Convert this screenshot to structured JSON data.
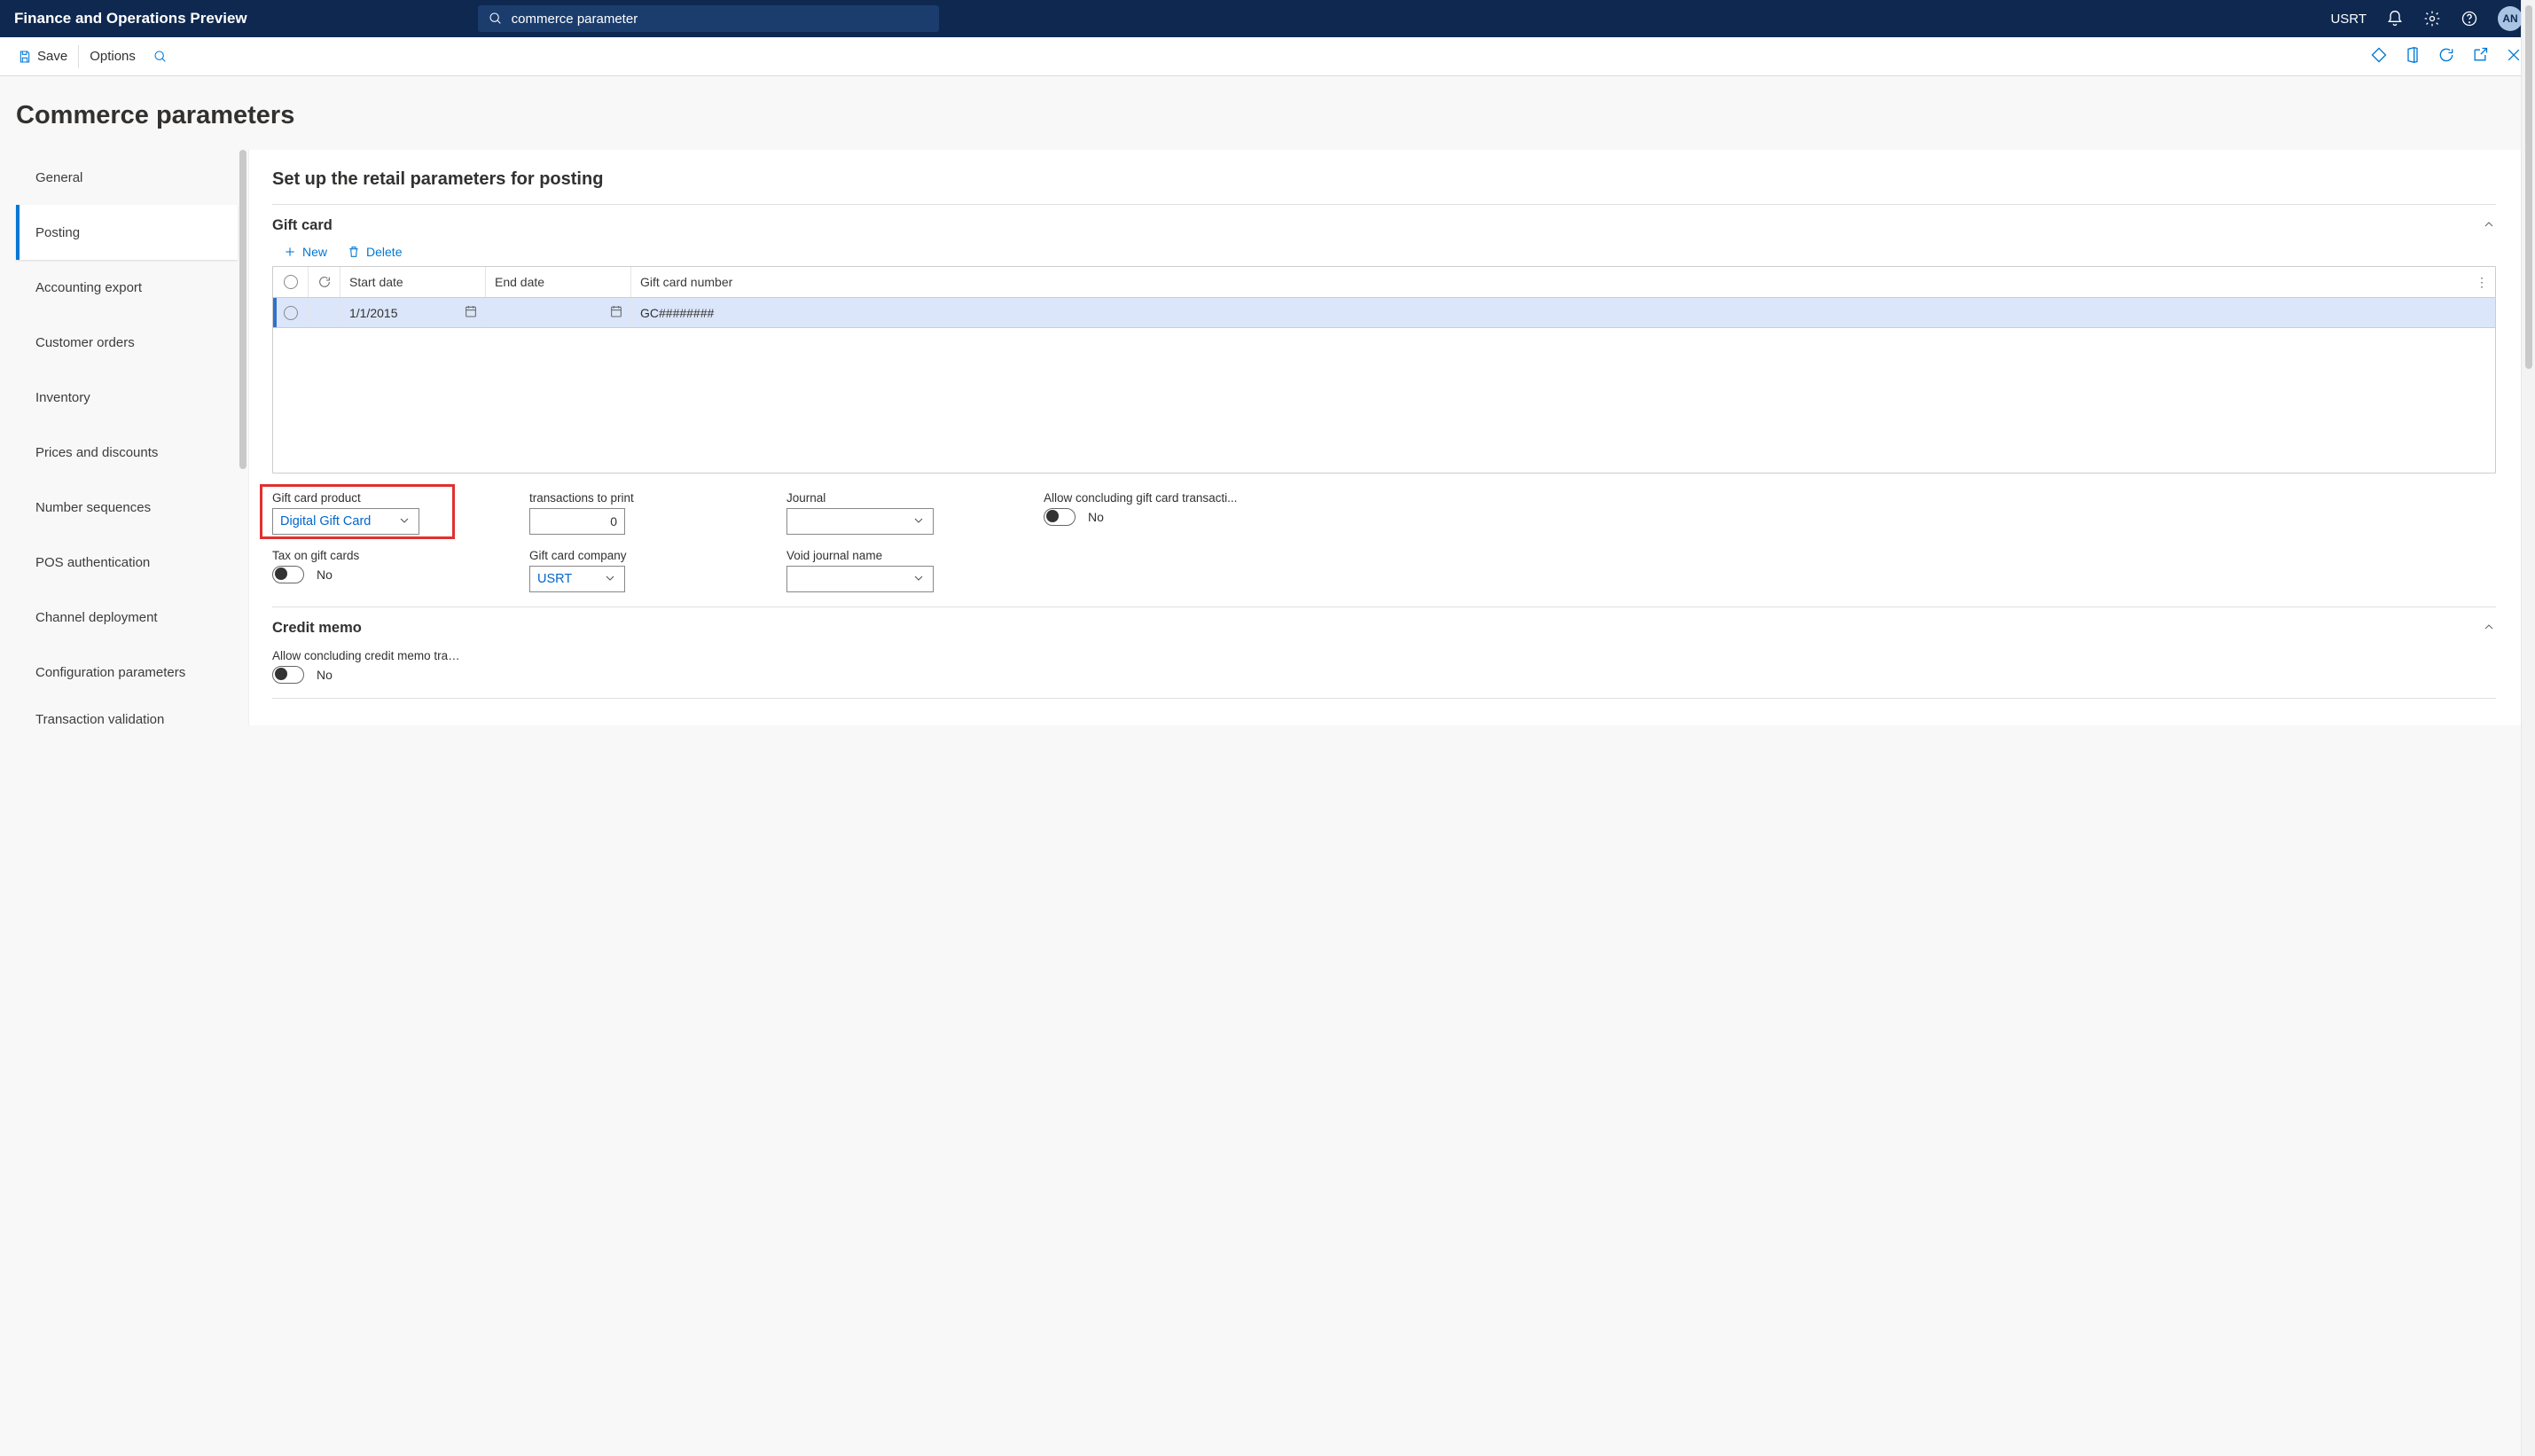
{
  "topbar": {
    "title": "Finance and Operations Preview",
    "search_value": "commerce parameter",
    "company": "USRT",
    "avatar": "AN"
  },
  "actionbar": {
    "save": "Save",
    "options": "Options"
  },
  "page": {
    "title": "Commerce parameters",
    "pane_title": "Set up the retail parameters for posting"
  },
  "sidebar": {
    "items": [
      {
        "label": "General"
      },
      {
        "label": "Posting"
      },
      {
        "label": "Accounting export"
      },
      {
        "label": "Customer orders"
      },
      {
        "label": "Inventory"
      },
      {
        "label": "Prices and discounts"
      },
      {
        "label": "Number sequences"
      },
      {
        "label": "POS authentication"
      },
      {
        "label": "Channel deployment"
      },
      {
        "label": "Configuration parameters"
      },
      {
        "label": "Transaction validation"
      }
    ],
    "selected_index": 1
  },
  "giftcard": {
    "title": "Gift card",
    "actions": {
      "new": "New",
      "delete": "Delete"
    },
    "columns": {
      "start_date": "Start date",
      "end_date": "End date",
      "gc_number": "Gift card number"
    },
    "rows": [
      {
        "start_date": "1/1/2015",
        "end_date": "",
        "gc_number": "GC########"
      }
    ],
    "fields": {
      "gift_card_product_label": "Gift card product",
      "gift_card_product_value": "Digital Gift Card",
      "transactions_to_print_label": "transactions to print",
      "transactions_to_print_value": "0",
      "journal_label": "Journal",
      "journal_value": "",
      "allow_concluding_label": "Allow concluding gift card transacti...",
      "allow_concluding_value": "No",
      "tax_on_gift_cards_label": "Tax on gift cards",
      "tax_on_gift_cards_value": "No",
      "gift_card_company_label": "Gift card company",
      "gift_card_company_value": "USRT",
      "void_journal_label": "Void journal name",
      "void_journal_value": ""
    }
  },
  "creditmemo": {
    "title": "Credit memo",
    "allow_concluding_label": "Allow concluding credit memo trans...",
    "allow_concluding_value": "No"
  }
}
